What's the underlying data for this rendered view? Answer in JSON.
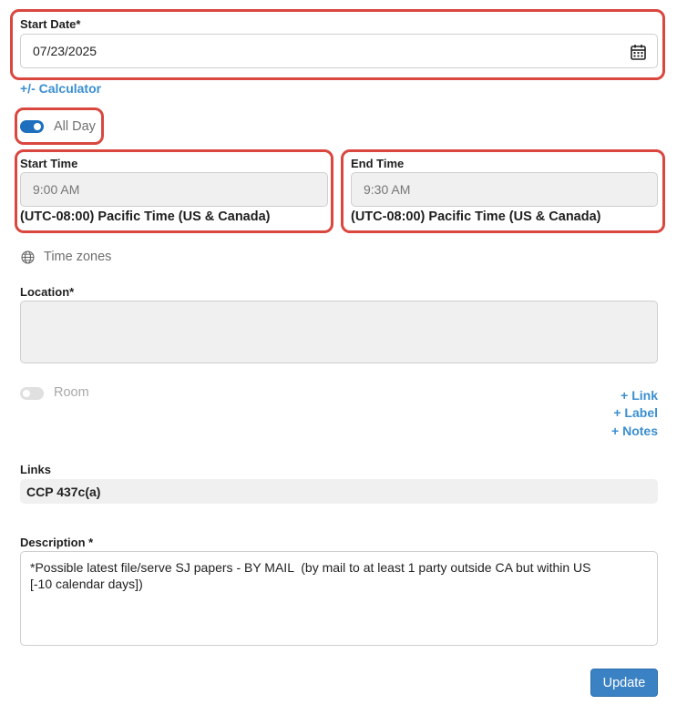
{
  "start_date": {
    "label": "Start Date*",
    "value": "07/23/2025",
    "calendar_icon": "calendar-icon"
  },
  "calculator_link": "+/- Calculator",
  "all_day": {
    "label": "All Day",
    "on": true
  },
  "start_time": {
    "label": "Start Time",
    "value": "9:00 AM",
    "timezone": "(UTC-08:00) Pacific Time (US & Canada)"
  },
  "end_time": {
    "label": "End Time",
    "value": "9:30 AM",
    "timezone": "(UTC-08:00) Pacific Time (US & Canada)"
  },
  "time_zones": {
    "label": "Time zones",
    "icon": "globe-icon"
  },
  "location": {
    "label": "Location*",
    "value": ""
  },
  "room": {
    "label": "Room",
    "on": false
  },
  "actions": {
    "add_link": "+ Link",
    "add_label": "+ Label",
    "add_notes": "+ Notes"
  },
  "links": {
    "label": "Links",
    "value": "CCP 437c(a)"
  },
  "description": {
    "label": "Description *",
    "line1": "*Possible latest file/serve SJ papers - BY MAIL  (by mail to at least 1 party outside CA but within US",
    "line2": "[-10 calendar days])"
  },
  "update_button": "Update",
  "colors": {
    "accent": "#3b8fd0",
    "highlight": "#d9473f",
    "toggle_on": "#1f6fbf"
  }
}
